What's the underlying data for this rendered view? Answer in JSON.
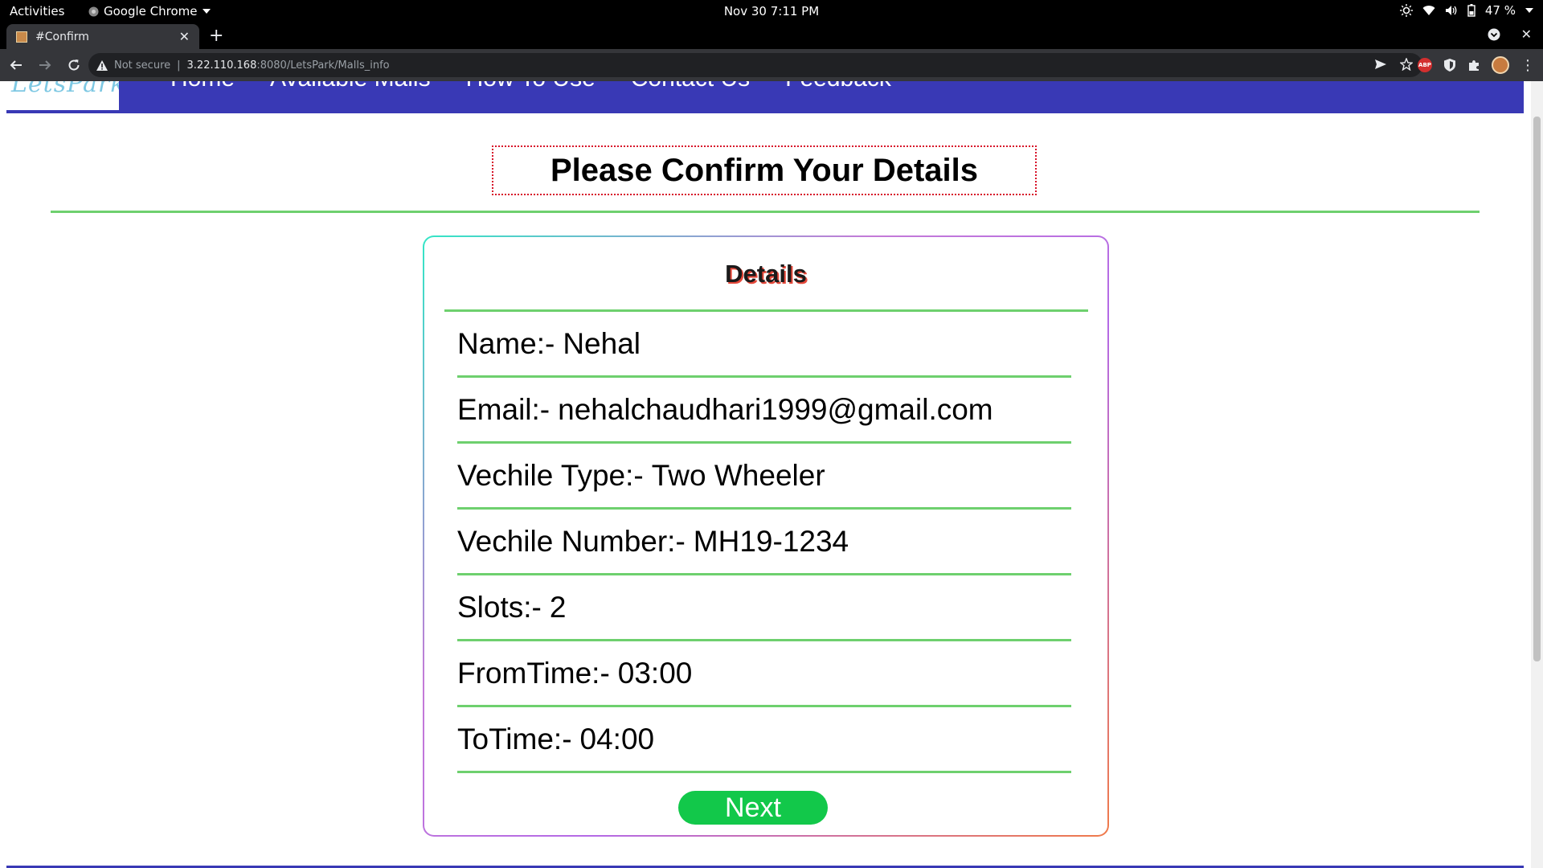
{
  "system_bar": {
    "activities": "Activities",
    "app_name": "Google Chrome",
    "clock": "Nov 30  7:11 PM",
    "battery": "47 %"
  },
  "browser": {
    "tab_title": "#Confirm",
    "security_label": "Not secure",
    "url_host": "3.22.110.168",
    "url_rest": ":8080/LetsPark/Malls_info"
  },
  "site": {
    "logo_text": "LetsPark",
    "nav": {
      "home": "Home",
      "available_malls": "Available Malls",
      "how_to_use": "How To Use",
      "contact_us": "Contact Us",
      "feedback": "Feedback"
    }
  },
  "page": {
    "heading": "Please Confirm Your Details",
    "card_title": "Details",
    "details": [
      {
        "label": "Name:-",
        "value": "Nehal"
      },
      {
        "label": "Email:-",
        "value": "nehalchaudhari1999@gmail.com"
      },
      {
        "label": "Vechile Type:-",
        "value": "Two Wheeler"
      },
      {
        "label": "Vechile Number:-",
        "value": "MH19-1234"
      },
      {
        "label": "Slots:-",
        "value": "2"
      },
      {
        "label": "FromTime:-",
        "value": "03:00"
      },
      {
        "label": "ToTime:-",
        "value": "04:00"
      }
    ],
    "next_button": "Next"
  },
  "colors": {
    "nav_bg": "#3939b5",
    "rule_green": "#6ed06e",
    "button_green": "#12c84a",
    "heading_border_red": "#d7142a"
  }
}
